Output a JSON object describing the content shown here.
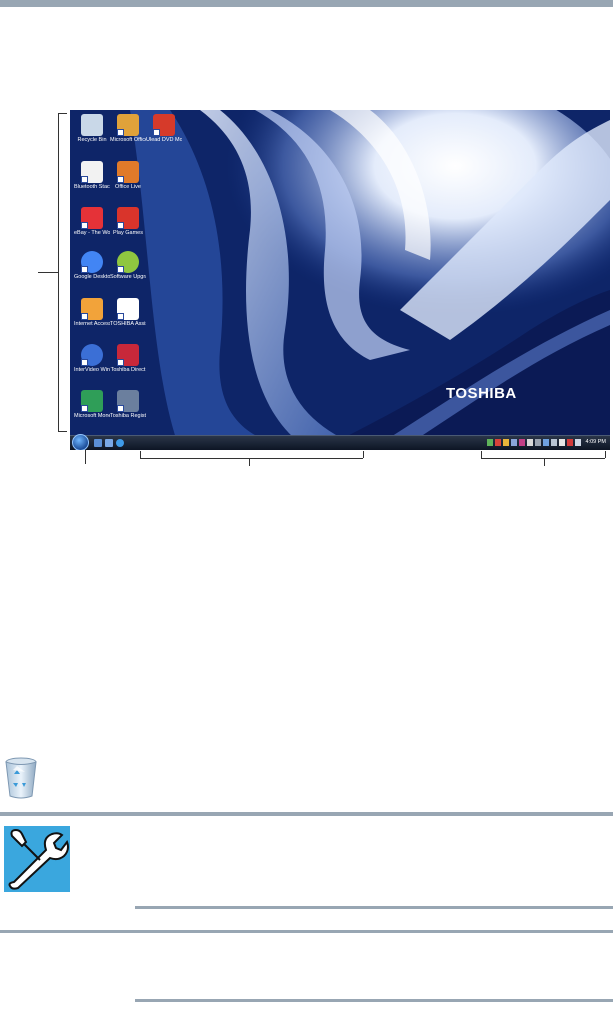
{
  "desktop": {
    "brand_text": "TOSHIBA",
    "icons": [
      {
        "label": "Recycle Bin",
        "icon": "recycle-bin-icon",
        "color": "#c9d8e8"
      },
      {
        "label": "Microsoft Office - ...",
        "icon": "office-icon",
        "color": "#e0a23a"
      },
      {
        "label": "Ulead DVD MovieFact...",
        "icon": "dvd-moviefactory-icon",
        "color": "#d63a2a"
      },
      {
        "label": "Bluetooth Stack Ins...",
        "icon": "document-icon",
        "color": "#f2f2f2"
      },
      {
        "label": "Office Live",
        "icon": "office-live-icon",
        "color": "#e07a2a"
      },
      {
        "label": "eBay - The World's O...",
        "icon": "ebay-icon",
        "color": "#e53238"
      },
      {
        "label": "Play Games",
        "icon": "play-games-icon",
        "color": "#d9342b"
      },
      {
        "label": "Google Desktop",
        "icon": "google-desktop-icon",
        "color": "#4285f4"
      },
      {
        "label": "Software Upgrades",
        "icon": "software-upgrades-icon",
        "color": "#8fc640"
      },
      {
        "label": "Internet Access",
        "icon": "internet-access-icon",
        "color": "#f2a33a"
      },
      {
        "label": "TOSHIBA Assist",
        "icon": "toshiba-assist-icon",
        "color": "#ffffff"
      },
      {
        "label": "InterVideo WinDVD f...",
        "icon": "windvd-icon",
        "color": "#3b6fd6"
      },
      {
        "label": "Toshiba Direct",
        "icon": "toshiba-direct-icon",
        "color": "#c8283a"
      },
      {
        "label": "Microsoft Money ...",
        "icon": "money-icon",
        "color": "#2f9e58"
      },
      {
        "label": "Toshiba Registration",
        "icon": "toshiba-registration-icon",
        "color": "#6b7f9e"
      }
    ],
    "taskbar": {
      "clock": "4:09 PM"
    }
  }
}
